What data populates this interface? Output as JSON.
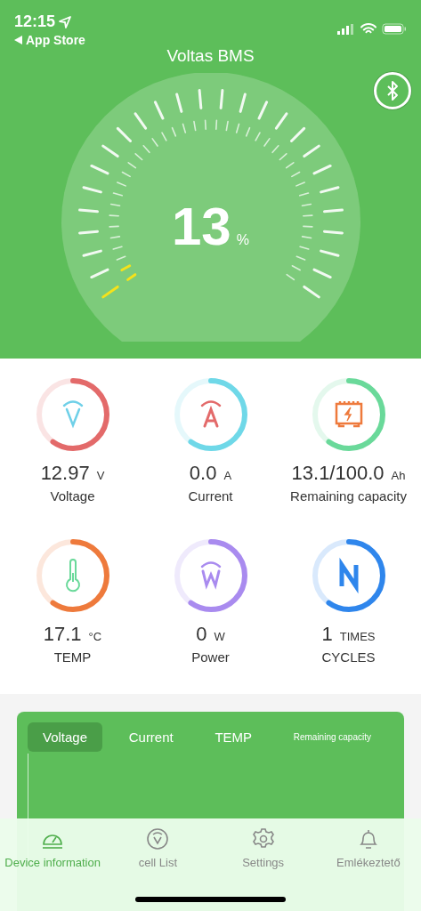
{
  "status_bar": {
    "time": "12:15",
    "back_label": "App Store"
  },
  "header": {
    "title": "Voltas BMS",
    "bluetooth_connected": true
  },
  "gauge": {
    "value": "13",
    "unit": "%"
  },
  "metrics": [
    {
      "kind": "voltage",
      "value": "12.97",
      "unit": "V",
      "label": "Voltage",
      "color": "#e36a6a"
    },
    {
      "kind": "current",
      "value": "0.0",
      "unit": "A",
      "label": "Current",
      "color": "#6fd8e8"
    },
    {
      "kind": "capacity",
      "value": "13.1/100.0",
      "unit": "Ah",
      "label": "Remaining capacity",
      "color": "#6ad99a"
    },
    {
      "kind": "temperature",
      "value": "17.1",
      "unit": "°C",
      "label": "TEMP",
      "color": "#ee7a3c"
    },
    {
      "kind": "power",
      "value": "0",
      "unit": "W",
      "label": "Power",
      "color": "#a98bef"
    },
    {
      "kind": "cycles",
      "value": "1",
      "unit": "TIMES",
      "label": "CYCLES",
      "color": "#2f86ec"
    }
  ],
  "chart_tabs": [
    {
      "label": "Voltage",
      "selected": true,
      "small": false
    },
    {
      "label": "Current",
      "selected": false,
      "small": false
    },
    {
      "label": "TEMP",
      "selected": false,
      "small": false
    },
    {
      "label": "Remaining capacity",
      "selected": false,
      "small": true
    }
  ],
  "tab_bar": [
    {
      "kind": "gauge",
      "label": "Device information",
      "selected": true
    },
    {
      "kind": "cell",
      "label": "cell List",
      "selected": false
    },
    {
      "kind": "settings",
      "label": "Settings",
      "selected": false
    },
    {
      "kind": "bell",
      "label": "Emlékeztető",
      "selected": false
    }
  ]
}
